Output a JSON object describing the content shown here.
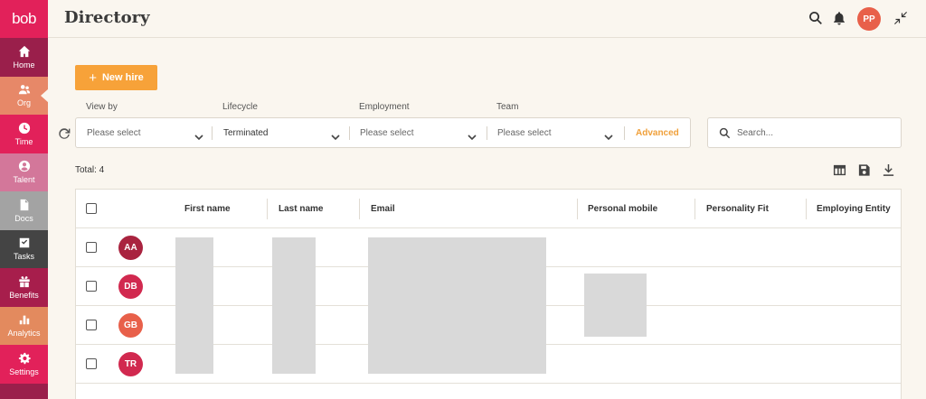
{
  "app": {
    "logo_text": "bob"
  },
  "sidebar": {
    "items": [
      {
        "label": "Home",
        "icon": "home-icon",
        "color": "#9a1f4b"
      },
      {
        "label": "Org",
        "icon": "people-icon",
        "color": "#e78868",
        "active": true
      },
      {
        "label": "Time",
        "icon": "clock-icon",
        "color": "#e2215a"
      },
      {
        "label": "Talent",
        "icon": "user-icon",
        "color": "#d3779a"
      },
      {
        "label": "Docs",
        "icon": "document-icon",
        "color": "#a3a3a3"
      },
      {
        "label": "Tasks",
        "icon": "checklist-icon",
        "color": "#444444"
      },
      {
        "label": "Benefits",
        "icon": "gift-icon",
        "color": "#a71e4c"
      },
      {
        "label": "Analytics",
        "icon": "bar-chart-icon",
        "color": "#e38a5e"
      },
      {
        "label": "Settings",
        "icon": "gear-icon",
        "color": "#e2215a"
      }
    ]
  },
  "header": {
    "title": "Directory",
    "user_initials": "PP",
    "icons": [
      "search-icon",
      "bell-icon",
      "collapse-icon"
    ]
  },
  "actions": {
    "new_hire_label": "New hire"
  },
  "filters": [
    {
      "label": "View by",
      "value": "Please select",
      "placeholder": true
    },
    {
      "label": "Lifecycle",
      "value": "Terminated",
      "placeholder": false
    },
    {
      "label": "Employment",
      "value": "Please select",
      "placeholder": true
    },
    {
      "label": "Team",
      "value": "Please select",
      "placeholder": true
    }
  ],
  "advanced_label": "Advanced",
  "search": {
    "placeholder": "Search..."
  },
  "summary": {
    "total_text": "Total: 4"
  },
  "toolbar_icons": [
    "table-columns-icon",
    "save-icon",
    "download-icon"
  ],
  "table": {
    "columns": [
      "First name",
      "Last name",
      "Email",
      "Personal mobile",
      "Personality Fit",
      "Employing Entity"
    ],
    "rows": [
      {
        "initials": "AA",
        "avatar_color": "#a9233f"
      },
      {
        "initials": "DB",
        "avatar_color": "#d1294f"
      },
      {
        "initials": "GB",
        "avatar_color": "#e8604a"
      },
      {
        "initials": "TR",
        "avatar_color": "#d1294f"
      }
    ]
  }
}
